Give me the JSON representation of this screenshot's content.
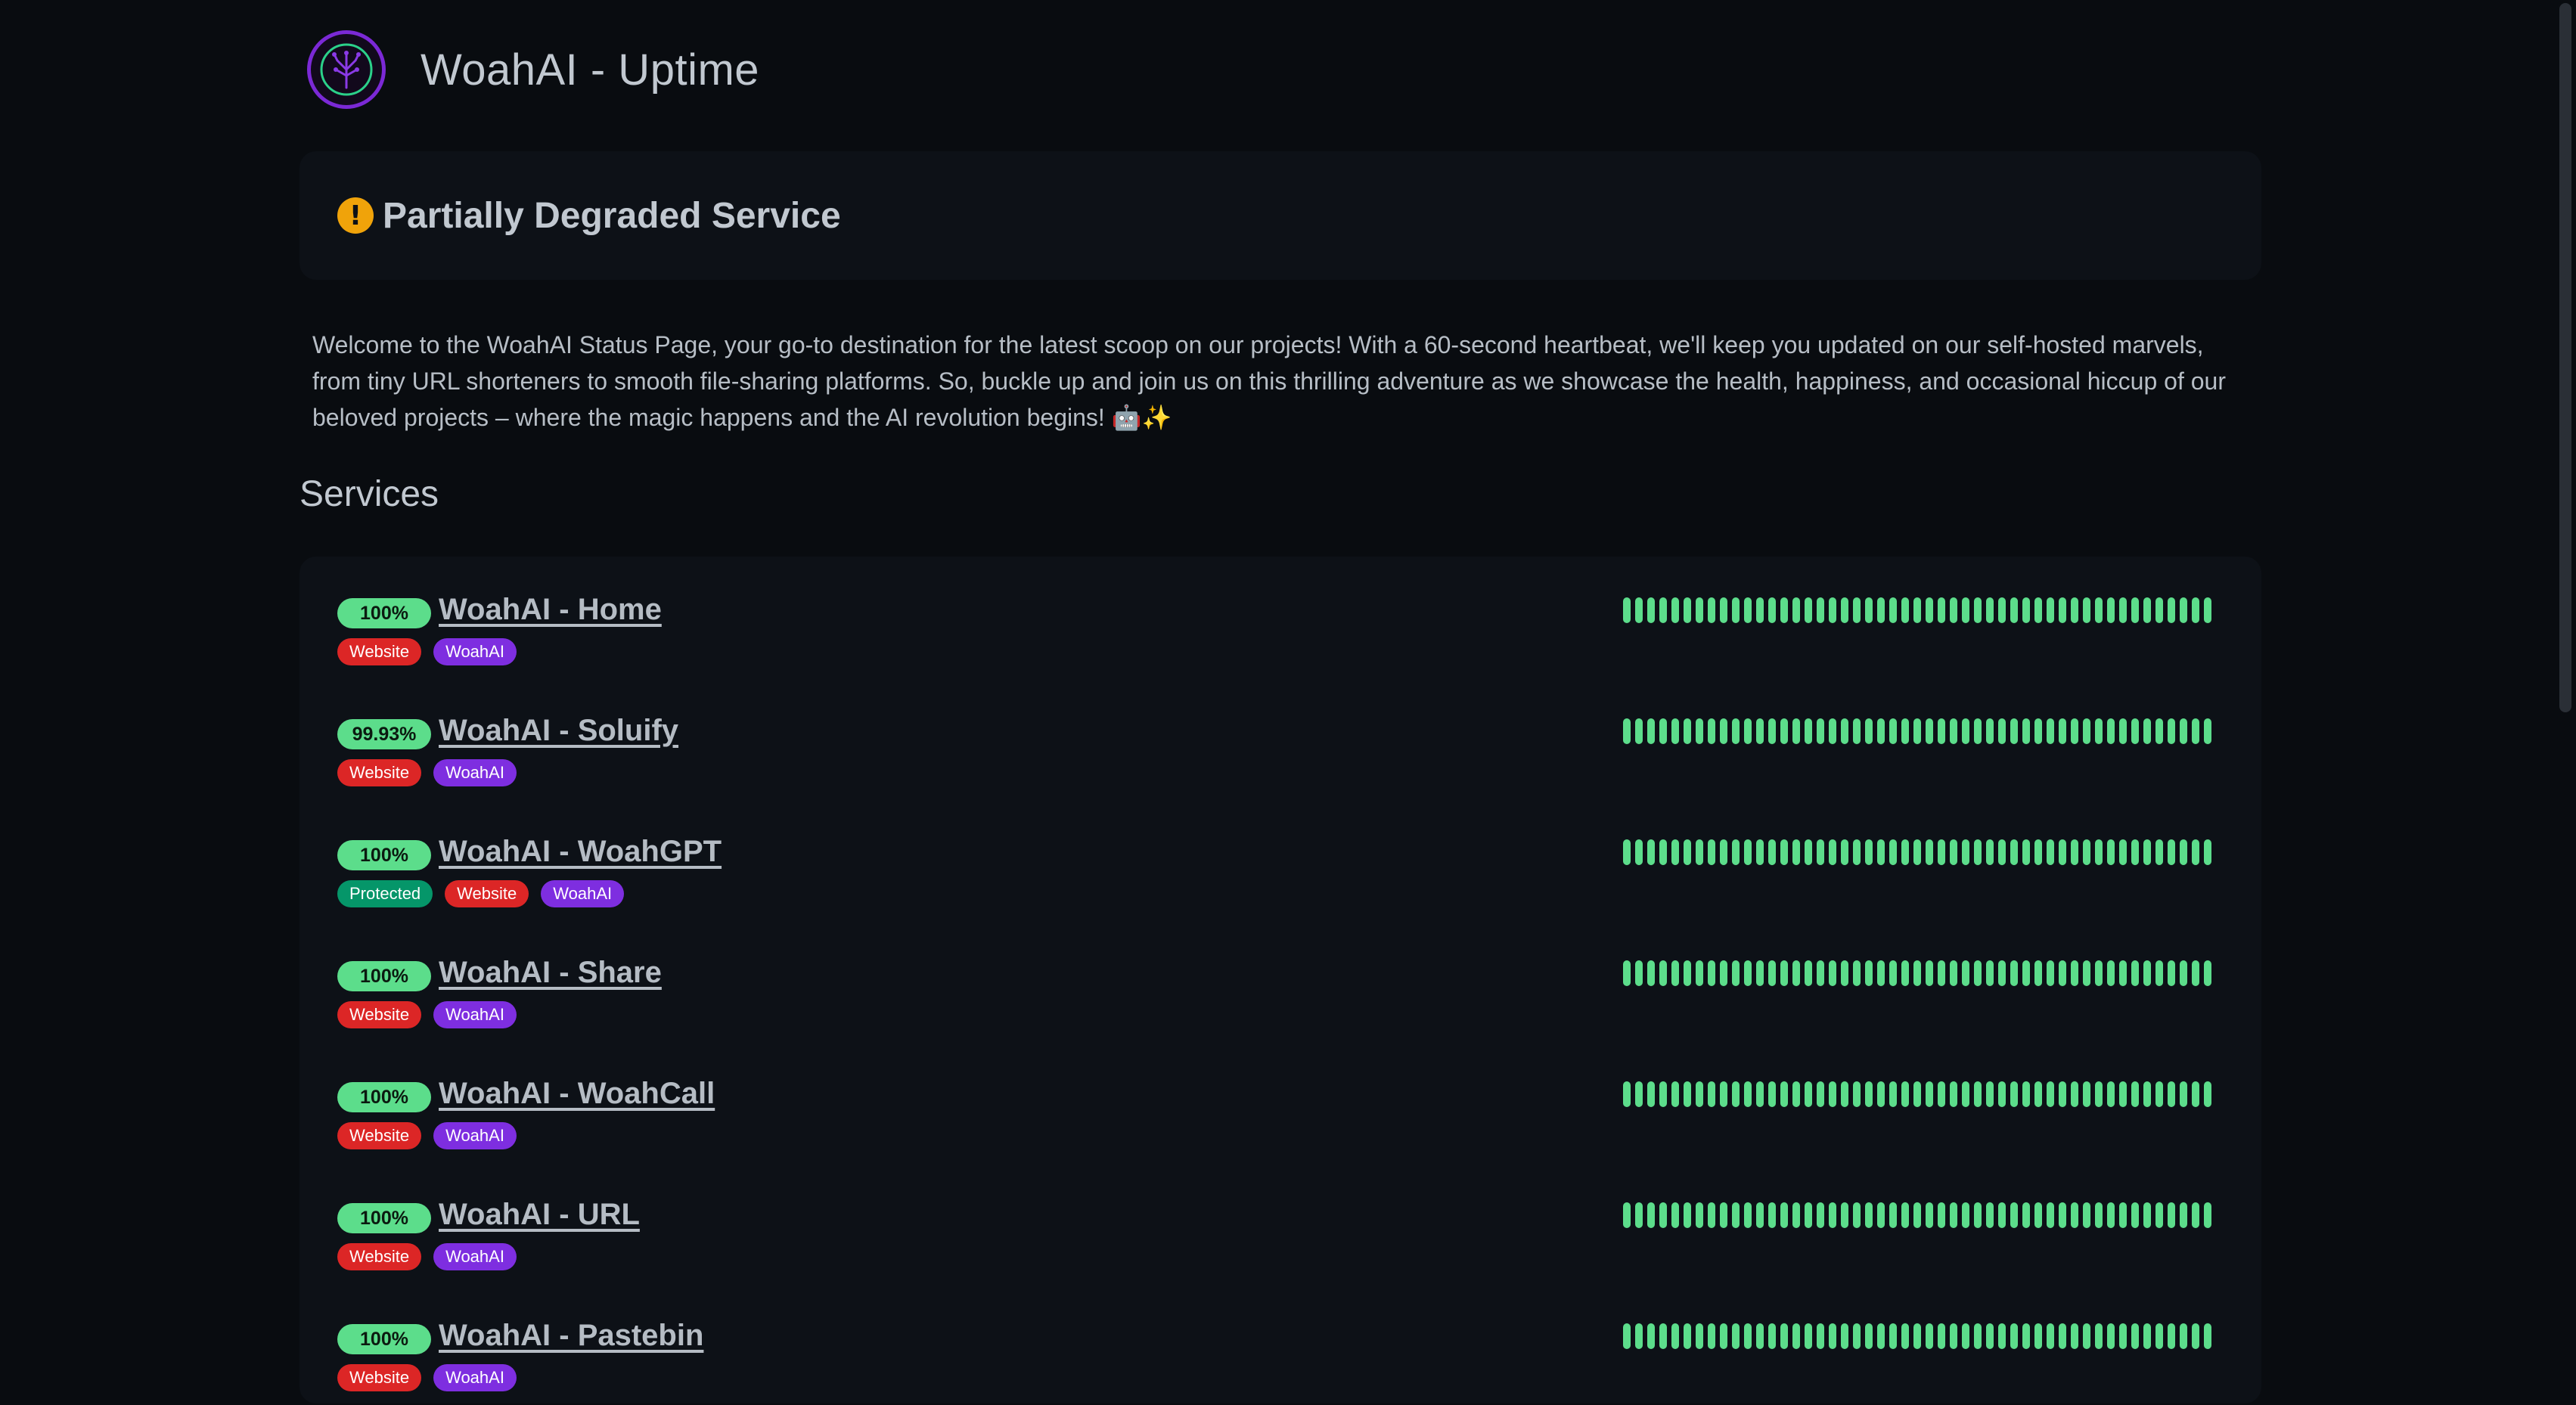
{
  "header": {
    "title": "WoahAI - Uptime",
    "logo_icon": "brain-tree-logo-icon"
  },
  "status": {
    "icon": "warning-icon",
    "icon_glyph": "!",
    "text": "Partially Degraded Service",
    "color": "#f0a30a"
  },
  "description": "Welcome to the WoahAI Status Page, your go-to destination for the latest scoop on our projects! With a 60-second heartbeat, we'll keep you updated on our self-hosted marvels, from tiny URL shorteners to smooth file-sharing platforms. So, buckle up and join us on this thrilling adventure as we showcase the health, happiness, and occasional hiccup of our beloved projects – where the magic happens and the AI revolution begins! 🤖✨",
  "services_heading": "Services",
  "colors": {
    "up": "#5cdd8b",
    "tag_website": "#dc2626",
    "tag_woahai": "#7e2ee0",
    "tag_protected": "#059669"
  },
  "services": [
    {
      "uptime": "100%",
      "name": "WoahAI - Home",
      "tags": [
        "Website",
        "WoahAI"
      ]
    },
    {
      "uptime": "99.93%",
      "name": "WoahAI - Soluify",
      "tags": [
        "Website",
        "WoahAI"
      ]
    },
    {
      "uptime": "100%",
      "name": "WoahAI - WoahGPT",
      "tags": [
        "Protected",
        "Website",
        "WoahAI"
      ]
    },
    {
      "uptime": "100%",
      "name": "WoahAI - Share",
      "tags": [
        "Website",
        "WoahAI"
      ]
    },
    {
      "uptime": "100%",
      "name": "WoahAI - WoahCall",
      "tags": [
        "Website",
        "WoahAI"
      ]
    },
    {
      "uptime": "100%",
      "name": "WoahAI - URL",
      "tags": [
        "Website",
        "WoahAI"
      ]
    },
    {
      "uptime": "100%",
      "name": "WoahAI - Pastebin",
      "tags": [
        "Website",
        "WoahAI"
      ]
    }
  ],
  "heartbeat_count": 49
}
